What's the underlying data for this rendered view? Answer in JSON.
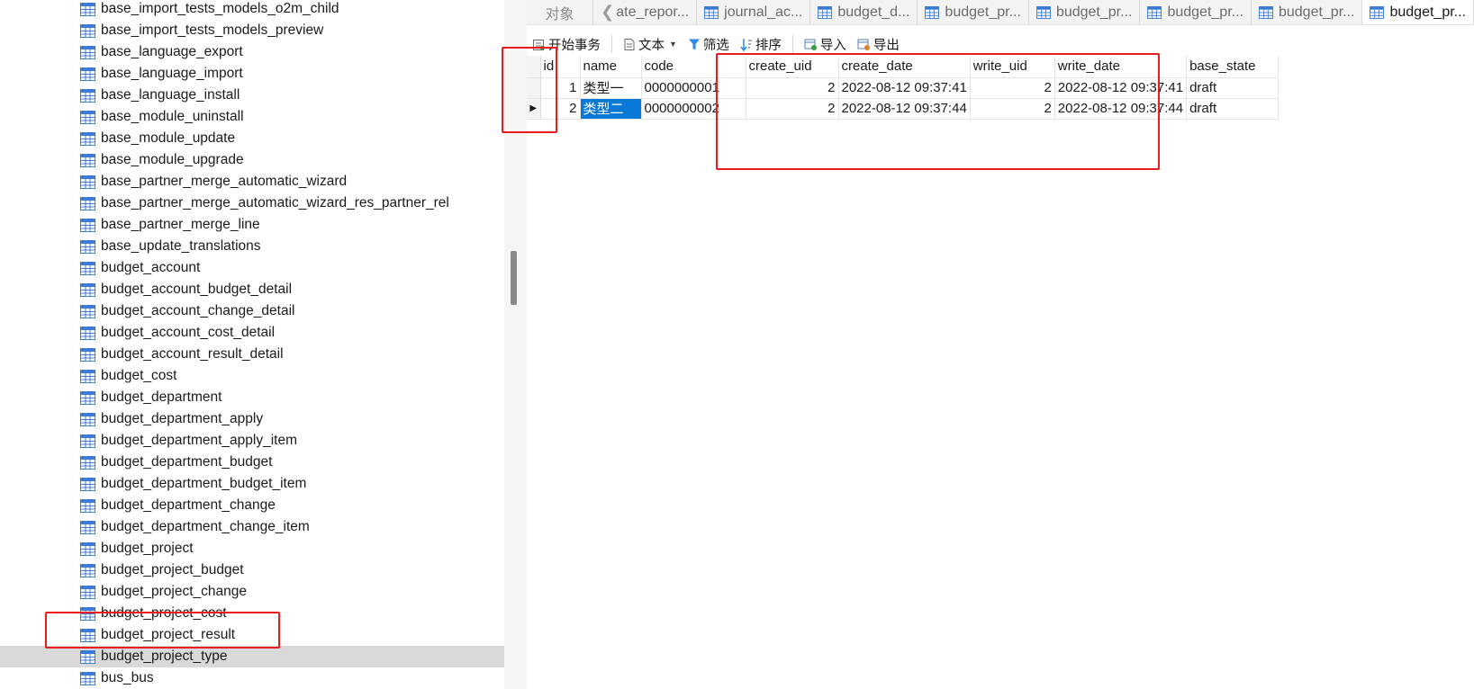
{
  "tree": {
    "items": [
      "base_import_tests_models_o2m_child",
      "base_import_tests_models_preview",
      "base_language_export",
      "base_language_import",
      "base_language_install",
      "base_module_uninstall",
      "base_module_update",
      "base_module_upgrade",
      "base_partner_merge_automatic_wizard",
      "base_partner_merge_automatic_wizard_res_partner_rel",
      "base_partner_merge_line",
      "base_update_translations",
      "budget_account",
      "budget_account_budget_detail",
      "budget_account_change_detail",
      "budget_account_cost_detail",
      "budget_account_result_detail",
      "budget_cost",
      "budget_department",
      "budget_department_apply",
      "budget_department_apply_item",
      "budget_department_budget",
      "budget_department_budget_item",
      "budget_department_change",
      "budget_department_change_item",
      "budget_project",
      "budget_project_budget",
      "budget_project_change",
      "budget_project_cost",
      "budget_project_result",
      "budget_project_type",
      "bus_bus"
    ],
    "selected_index": 30
  },
  "tabs": {
    "objects": "对象",
    "items": [
      "ate_repor...",
      "journal_ac...",
      "budget_d...",
      "budget_pr...",
      "budget_pr...",
      "budget_pr...",
      "budget_pr...",
      "budget_pr..."
    ],
    "active_index": 7
  },
  "toolbar": {
    "begin_transaction": "开始事务",
    "text": "文本",
    "filter": "筛选",
    "sort": "排序",
    "import": "导入",
    "export": "导出"
  },
  "grid": {
    "columns": [
      "id",
      "name",
      "code",
      "create_uid",
      "create_date",
      "write_uid",
      "write_date",
      "base_state"
    ],
    "rows": [
      {
        "id": "1",
        "name": "类型一",
        "code": "0000000001",
        "create_uid": "2",
        "create_date": "2022-08-12 09:37:41",
        "write_uid": "2",
        "write_date": "2022-08-12 09:37:41",
        "base_state": "draft"
      },
      {
        "id": "2",
        "name": "类型二",
        "code": "0000000002",
        "create_uid": "2",
        "create_date": "2022-08-12 09:37:44",
        "write_uid": "2",
        "write_date": "2022-08-12 09:37:44",
        "base_state": "draft"
      }
    ],
    "current_row_index": 1
  },
  "colors": {
    "annotation_red": "#ea1c1c",
    "selection_blue": "#0a78d7",
    "tree_selected_bg": "#d9d9d9"
  }
}
